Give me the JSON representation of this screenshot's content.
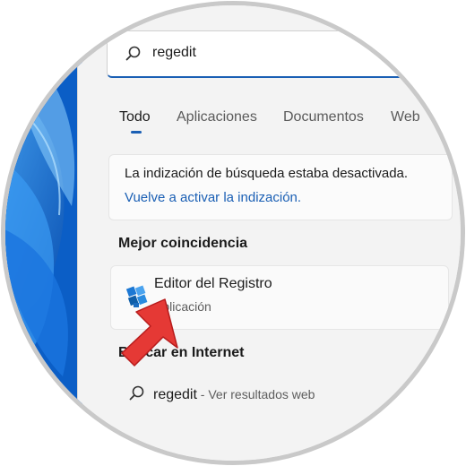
{
  "search": {
    "query": "regedit"
  },
  "tabs": [
    {
      "label": "Todo",
      "active": true
    },
    {
      "label": "Aplicaciones",
      "active": false
    },
    {
      "label": "Documentos",
      "active": false
    },
    {
      "label": "Web",
      "active": false
    }
  ],
  "notice": {
    "text": "La indización de búsqueda estaba desactivada.",
    "link": "Vuelve a activar la indización."
  },
  "best_match": {
    "heading": "Mejor coincidencia",
    "title": "Editor del Registro",
    "subtitle": "Aplicación",
    "icon": "registry-editor-icon"
  },
  "web": {
    "heading": "Buscar en Internet",
    "query": "regedit",
    "suffix": " - Ver resultados web"
  },
  "colors": {
    "accent": "#1a5fb4",
    "arrow": "#e53935",
    "wallpaper": "#0d63c9"
  }
}
